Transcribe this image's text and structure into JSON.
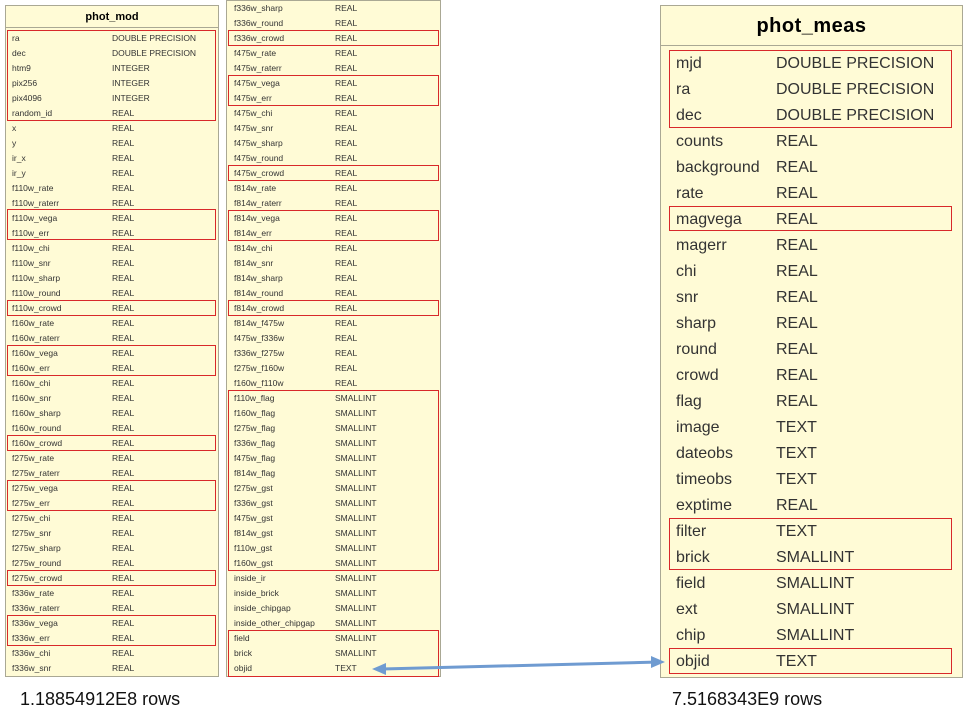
{
  "tables": {
    "phot_mod": {
      "title": "phot_mod",
      "row_count": "1.18854912E8 rows",
      "col1": [
        [
          "ra",
          "DOUBLE PRECISION"
        ],
        [
          "dec",
          "DOUBLE PRECISION"
        ],
        [
          "htm9",
          "INTEGER"
        ],
        [
          "pix256",
          "INTEGER"
        ],
        [
          "pix4096",
          "INTEGER"
        ],
        [
          "random_id",
          "REAL"
        ],
        [
          "x",
          "REAL"
        ],
        [
          "y",
          "REAL"
        ],
        [
          "ir_x",
          "REAL"
        ],
        [
          "ir_y",
          "REAL"
        ],
        [
          "f110w_rate",
          "REAL"
        ],
        [
          "f110w_raterr",
          "REAL"
        ],
        [
          "f110w_vega",
          "REAL"
        ],
        [
          "f110w_err",
          "REAL"
        ],
        [
          "f110w_chi",
          "REAL"
        ],
        [
          "f110w_snr",
          "REAL"
        ],
        [
          "f110w_sharp",
          "REAL"
        ],
        [
          "f110w_round",
          "REAL"
        ],
        [
          "f110w_crowd",
          "REAL"
        ],
        [
          "f160w_rate",
          "REAL"
        ],
        [
          "f160w_raterr",
          "REAL"
        ],
        [
          "f160w_vega",
          "REAL"
        ],
        [
          "f160w_err",
          "REAL"
        ],
        [
          "f160w_chi",
          "REAL"
        ],
        [
          "f160w_snr",
          "REAL"
        ],
        [
          "f160w_sharp",
          "REAL"
        ],
        [
          "f160w_round",
          "REAL"
        ],
        [
          "f160w_crowd",
          "REAL"
        ],
        [
          "f275w_rate",
          "REAL"
        ],
        [
          "f275w_raterr",
          "REAL"
        ],
        [
          "f275w_vega",
          "REAL"
        ],
        [
          "f275w_err",
          "REAL"
        ],
        [
          "f275w_chi",
          "REAL"
        ],
        [
          "f275w_snr",
          "REAL"
        ],
        [
          "f275w_sharp",
          "REAL"
        ],
        [
          "f275w_round",
          "REAL"
        ],
        [
          "f275w_crowd",
          "REAL"
        ],
        [
          "f336w_rate",
          "REAL"
        ],
        [
          "f336w_raterr",
          "REAL"
        ],
        [
          "f336w_vega",
          "REAL"
        ],
        [
          "f336w_err",
          "REAL"
        ],
        [
          "f336w_chi",
          "REAL"
        ],
        [
          "f336w_snr",
          "REAL"
        ]
      ],
      "col2": [
        [
          "f336w_sharp",
          "REAL"
        ],
        [
          "f336w_round",
          "REAL"
        ],
        [
          "f336w_crowd",
          "REAL"
        ],
        [
          "f475w_rate",
          "REAL"
        ],
        [
          "f475w_raterr",
          "REAL"
        ],
        [
          "f475w_vega",
          "REAL"
        ],
        [
          "f475w_err",
          "REAL"
        ],
        [
          "f475w_chi",
          "REAL"
        ],
        [
          "f475w_snr",
          "REAL"
        ],
        [
          "f475w_sharp",
          "REAL"
        ],
        [
          "f475w_round",
          "REAL"
        ],
        [
          "f475w_crowd",
          "REAL"
        ],
        [
          "f814w_rate",
          "REAL"
        ],
        [
          "f814w_raterr",
          "REAL"
        ],
        [
          "f814w_vega",
          "REAL"
        ],
        [
          "f814w_err",
          "REAL"
        ],
        [
          "f814w_chi",
          "REAL"
        ],
        [
          "f814w_snr",
          "REAL"
        ],
        [
          "f814w_sharp",
          "REAL"
        ],
        [
          "f814w_round",
          "REAL"
        ],
        [
          "f814w_crowd",
          "REAL"
        ],
        [
          "f814w_f475w",
          "REAL"
        ],
        [
          "f475w_f336w",
          "REAL"
        ],
        [
          "f336w_f275w",
          "REAL"
        ],
        [
          "f275w_f160w",
          "REAL"
        ],
        [
          "f160w_f110w",
          "REAL"
        ],
        [
          "f110w_flag",
          "SMALLINT"
        ],
        [
          "f160w_flag",
          "SMALLINT"
        ],
        [
          "f275w_flag",
          "SMALLINT"
        ],
        [
          "f336w_flag",
          "SMALLINT"
        ],
        [
          "f475w_flag",
          "SMALLINT"
        ],
        [
          "f814w_flag",
          "SMALLINT"
        ],
        [
          "f275w_gst",
          "SMALLINT"
        ],
        [
          "f336w_gst",
          "SMALLINT"
        ],
        [
          "f475w_gst",
          "SMALLINT"
        ],
        [
          "f814w_gst",
          "SMALLINT"
        ],
        [
          "f110w_gst",
          "SMALLINT"
        ],
        [
          "f160w_gst",
          "SMALLINT"
        ],
        [
          "inside_ir",
          "SMALLINT"
        ],
        [
          "inside_brick",
          "SMALLINT"
        ],
        [
          "inside_chipgap",
          "SMALLINT"
        ],
        [
          "inside_other_chipgap",
          "SMALLINT"
        ],
        [
          "field",
          "SMALLINT"
        ],
        [
          "brick",
          "SMALLINT"
        ],
        [
          "objid",
          "TEXT"
        ]
      ]
    },
    "phot_meas": {
      "title": "phot_meas",
      "row_count": "7.5168343E9 rows",
      "rows": [
        [
          "mjd",
          "DOUBLE PRECISION"
        ],
        [
          "ra",
          "DOUBLE PRECISION"
        ],
        [
          "dec",
          "DOUBLE PRECISION"
        ],
        [
          "counts",
          "REAL"
        ],
        [
          "background",
          "REAL"
        ],
        [
          "rate",
          "REAL"
        ],
        [
          "magvega",
          "REAL"
        ],
        [
          "magerr",
          "REAL"
        ],
        [
          "chi",
          "REAL"
        ],
        [
          "snr",
          "REAL"
        ],
        [
          "sharp",
          "REAL"
        ],
        [
          "round",
          "REAL"
        ],
        [
          "crowd",
          "REAL"
        ],
        [
          "flag",
          "REAL"
        ],
        [
          "image",
          "TEXT"
        ],
        [
          "dateobs",
          "TEXT"
        ],
        [
          "timeobs",
          "TEXT"
        ],
        [
          "exptime",
          "REAL"
        ],
        [
          "filter",
          "TEXT"
        ],
        [
          "brick",
          "SMALLINT"
        ],
        [
          "field",
          "SMALLINT"
        ],
        [
          "ext",
          "SMALLINT"
        ],
        [
          "chip",
          "SMALLINT"
        ],
        [
          "objid",
          "TEXT"
        ]
      ]
    }
  },
  "highlight_color": "#d8282a",
  "link_color": "#6f9bd1"
}
